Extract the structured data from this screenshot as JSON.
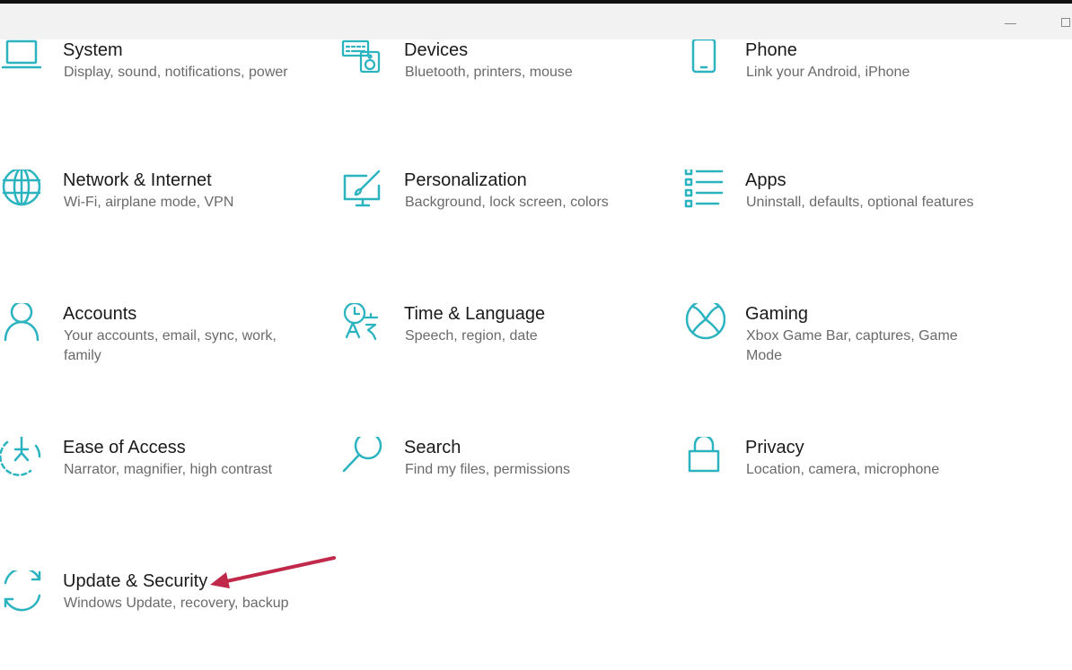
{
  "window": {
    "minimize_icon": "minimize-icon",
    "maximize_icon": "maximize-icon"
  },
  "settings": {
    "tiles": [
      {
        "title": "System",
        "description": "Display, sound, notifications, power",
        "icon": "laptop-icon"
      },
      {
        "title": "Devices",
        "description": "Bluetooth, printers, mouse",
        "icon": "keyboard-speaker-icon"
      },
      {
        "title": "Phone",
        "description": "Link your Android, iPhone",
        "icon": "phone-icon"
      },
      {
        "title": "Network & Internet",
        "description": "Wi-Fi, airplane mode, VPN",
        "icon": "globe-icon"
      },
      {
        "title": "Personalization",
        "description": "Background, lock screen, colors",
        "icon": "paint-monitor-icon"
      },
      {
        "title": "Apps",
        "description": "Uninstall, defaults, optional features",
        "icon": "apps-list-icon"
      },
      {
        "title": "Accounts",
        "description": "Your accounts, email, sync, work, family",
        "icon": "person-icon"
      },
      {
        "title": "Time & Language",
        "description": "Speech, region, date",
        "icon": "time-language-icon"
      },
      {
        "title": "Gaming",
        "description": "Xbox Game Bar, captures, Game Mode",
        "icon": "xbox-icon"
      },
      {
        "title": "Ease of Access",
        "description": "Narrator, magnifier, high contrast",
        "icon": "ease-of-access-icon"
      },
      {
        "title": "Search",
        "description": "Find my files, permissions",
        "icon": "search-icon"
      },
      {
        "title": "Privacy",
        "description": "Location, camera, microphone",
        "icon": "lock-icon"
      },
      {
        "title": "Update & Security",
        "description": "Windows Update, recovery, backup",
        "icon": "sync-arrows-icon"
      }
    ]
  },
  "colors": {
    "accent": "#2bb3c0",
    "annotation": "#c0294a"
  },
  "annotation": {
    "icon": "red-arrow-icon"
  }
}
